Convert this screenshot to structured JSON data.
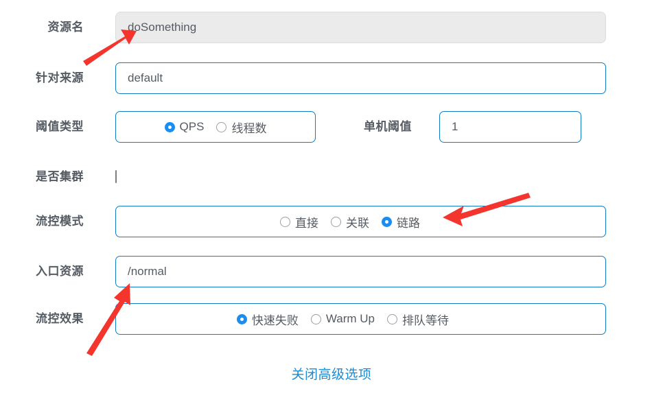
{
  "form": {
    "rows": [
      {
        "label": "资源名",
        "type": "input-disabled",
        "value": "doSomething"
      },
      {
        "label": "针对来源",
        "type": "input",
        "value": "default"
      },
      {
        "label": "阈值类型",
        "type": "radio",
        "options": [
          {
            "label": "QPS",
            "checked": true
          },
          {
            "label": "线程数",
            "checked": false
          }
        ],
        "secondary_label": "单机阈值",
        "secondary_value": "1"
      },
      {
        "label": "是否集群",
        "type": "checkbox",
        "checked": false
      },
      {
        "label": "流控模式",
        "type": "radio",
        "options": [
          {
            "label": "直接",
            "checked": false
          },
          {
            "label": "关联",
            "checked": false
          },
          {
            "label": "链路",
            "checked": true
          }
        ]
      },
      {
        "label": "入口资源",
        "type": "input",
        "value": "/normal"
      },
      {
        "label": "流控效果",
        "type": "radio",
        "options": [
          {
            "label": "快速失败",
            "checked": true
          },
          {
            "label": "Warm Up",
            "checked": false
          },
          {
            "label": "排队等待",
            "checked": false
          }
        ]
      }
    ],
    "advanced_link": "关闭高级选项"
  },
  "colors": {
    "border_active": "#0f7dc2",
    "radio_selected": "#1c8cf0",
    "link": "#1b8ad4",
    "label_text": "#555b63",
    "disabled_bg": "#ebebeb",
    "annotation_arrow": "#f4352e"
  },
  "annotations": [
    {
      "name": "arrow-to-resource-name",
      "points_to": "资源名 input"
    },
    {
      "name": "arrow-to-flow-mode-link",
      "points_to": "链路 radio"
    },
    {
      "name": "arrow-to-entry-resource",
      "points_to": "入口资源 input"
    }
  ]
}
